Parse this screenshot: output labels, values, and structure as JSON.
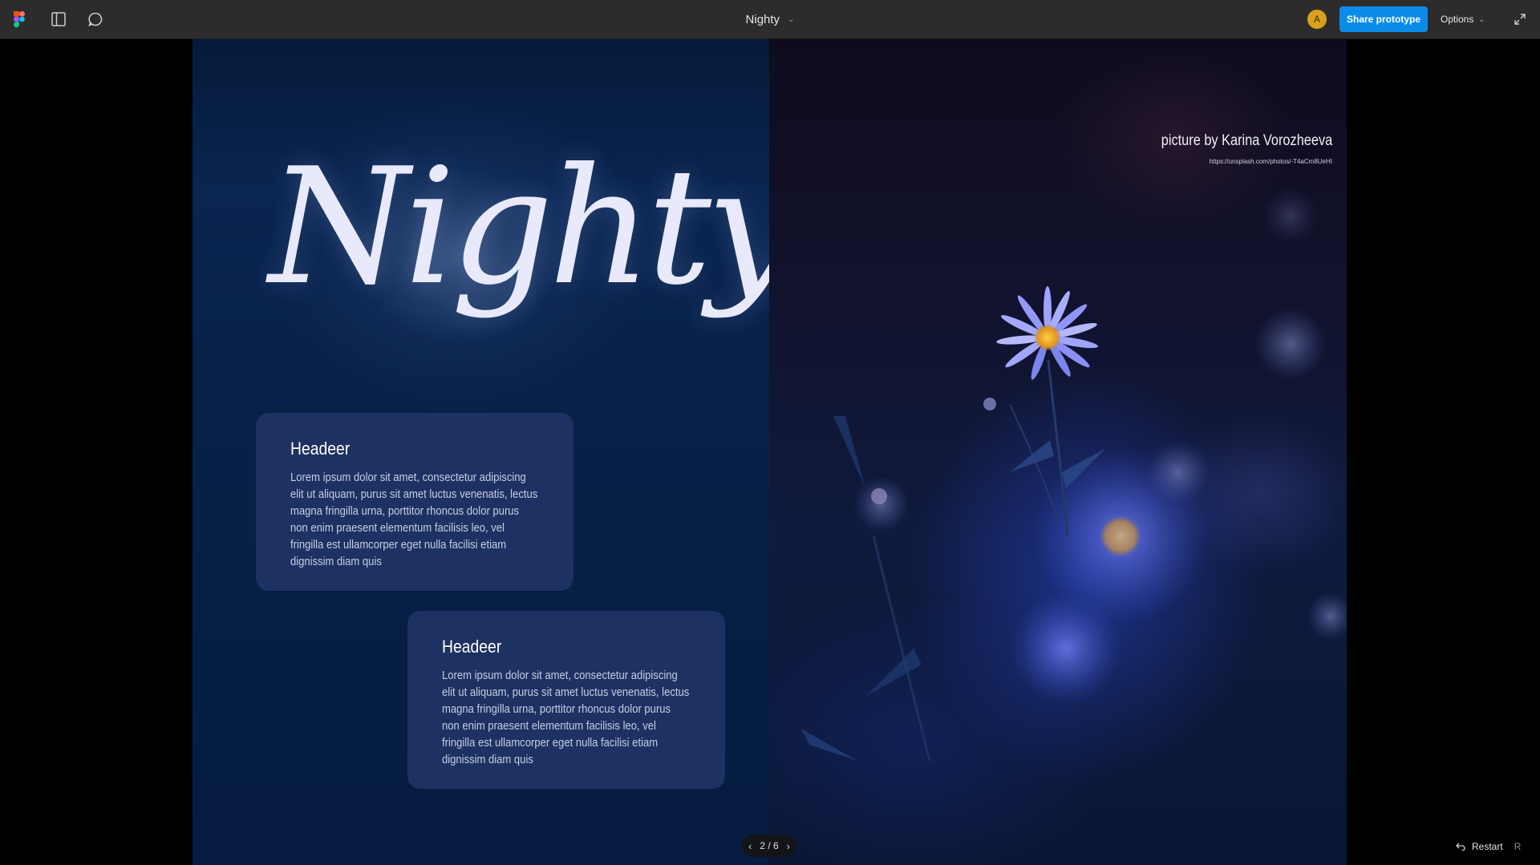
{
  "toolbar": {
    "file_name": "Nighty",
    "avatar_initial": "A",
    "share_label": "Share prototype",
    "options_label": "Options",
    "icons": [
      "figma-logo",
      "sidebar-toggle-icon",
      "comment-icon",
      "chevron-down-icon",
      "fullscreen-icon"
    ]
  },
  "slide": {
    "title": "Nighty",
    "cards": [
      {
        "title": "Headeer",
        "text": "Lorem ipsum dolor sit amet, consectetur adipiscing elit ut aliquam, purus sit amet luctus venenatis, lectus magna fringilla urna, porttitor rhoncus dolor purus non enim praesent elementum facilisis leo, vel fringilla est ullamcorper eget nulla facilisi etiam dignissim diam quis"
      },
      {
        "title": "Headeer",
        "text": "Lorem ipsum dolor sit amet, consectetur adipiscing elit ut aliquam, purus sit amet luctus venenatis, lectus magna fringilla urna, porttitor rhoncus dolor purus non enim praesent elementum facilisis leo, vel fringilla est ullamcorper eget nulla facilisi etiam dignissim diam quis"
      }
    ],
    "photo_credit": "picture by Karina Vorozheeva",
    "photo_url": "https://unsplash.com/photos/-T4aCm8UeHI"
  },
  "pager": {
    "label": "2 / 6",
    "current": 2,
    "total": 6
  },
  "restart": {
    "label": "Restart",
    "shortcut": "R"
  },
  "colors": {
    "toolbar_bg": "#2c2c2c",
    "accent": "#0c8ce9",
    "avatar": "#d9a21a",
    "slide_bg": "#061c40",
    "card_bg": "#1d3262"
  }
}
